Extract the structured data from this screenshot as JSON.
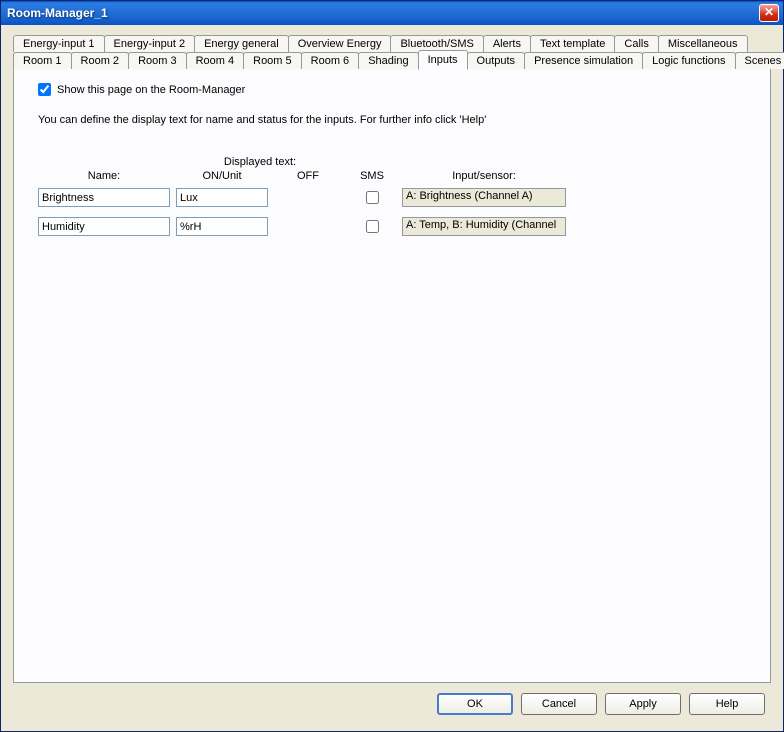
{
  "window": {
    "title": "Room-Manager_1"
  },
  "tabs_row1": [
    "Energy-input 1",
    "Energy-input 2",
    "Energy general",
    "Overview Energy",
    "Bluetooth/SMS",
    "Alerts",
    "Text template",
    "Calls",
    "Miscellaneous"
  ],
  "tabs_row2": [
    "Room 1",
    "Room 2",
    "Room 3",
    "Room 4",
    "Room 5",
    "Room 6",
    "Shading",
    "Inputs",
    "Outputs",
    "Presence simulation",
    "Logic functions",
    "Scenes"
  ],
  "active_tab": "Inputs",
  "checkbox": {
    "label": "Show this page on the Room-Manager",
    "checked": true
  },
  "description": "You can define the display text for name and status for the inputs. For further info click 'Help'",
  "headers": {
    "name": "Name:",
    "displayed": "Displayed text:",
    "on_unit": "ON/Unit",
    "off": "OFF",
    "sms": "SMS",
    "sensor": "Input/sensor:"
  },
  "rows": [
    {
      "name": "Brightness",
      "on": "Lux",
      "off": "",
      "sms": false,
      "sensor": "A: Brightness  (Channel A)"
    },
    {
      "name": "Humidity",
      "on": "%rH",
      "off": "",
      "sms": false,
      "sensor": "A: Temp, B: Humidity  (Channel"
    }
  ],
  "buttons": {
    "ok": "OK",
    "cancel": "Cancel",
    "apply": "Apply",
    "help": "Help"
  }
}
